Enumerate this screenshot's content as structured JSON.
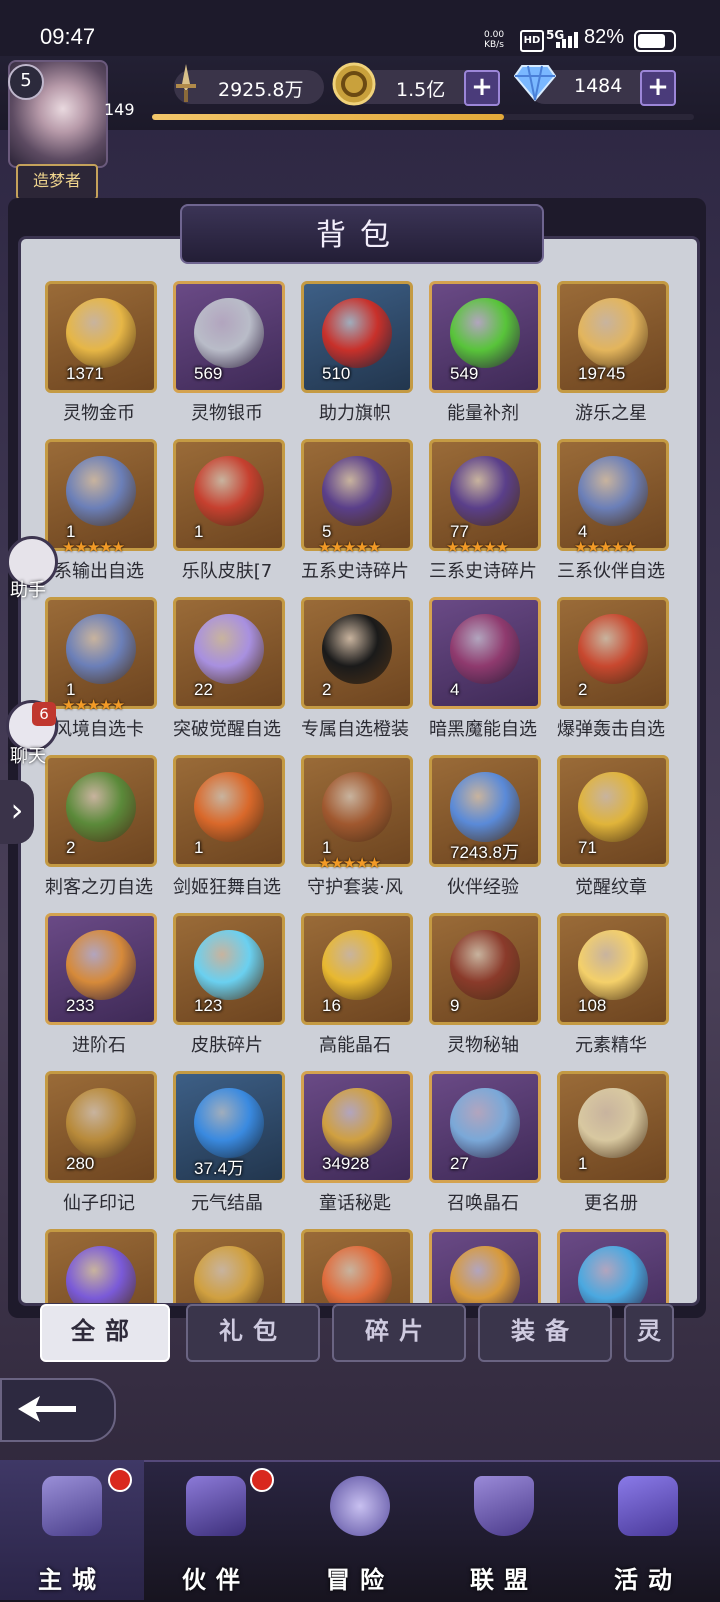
{
  "status_bar": {
    "time": "09:47",
    "net_speed_value": "0.00",
    "net_speed_unit": "KB/s",
    "hd": "HD",
    "signal": "5G",
    "battery": "82%",
    "battery_level": 0.82
  },
  "player": {
    "level": "5",
    "exp": "149",
    "exp_progress": 0.65,
    "title": "造梦者"
  },
  "resources": {
    "power": "2925.8万",
    "gold": "1.5亿",
    "diamond": "1484",
    "plus": "+"
  },
  "panel": {
    "title": "背包"
  },
  "items": [
    {
      "name": "灵物金币",
      "count": "1371",
      "style": "gold",
      "color": "#e6b646",
      "stars": ""
    },
    {
      "name": "灵物银币",
      "count": "569",
      "style": "purple",
      "color": "#b9bcc8",
      "stars": ""
    },
    {
      "name": "助力旗帜",
      "count": "510",
      "style": "blue",
      "color": "#c8302a",
      "stars": ""
    },
    {
      "name": "能量补剂",
      "count": "549",
      "style": "purple",
      "color": "#58c43a",
      "stars": ""
    },
    {
      "name": "游乐之星",
      "count": "19745",
      "style": "gold",
      "color": "#e3b55c",
      "stars": ""
    },
    {
      "name": "系输出自选",
      "count": "1",
      "style": "gold",
      "color": "#6b7fb8",
      "stars": "★★★★★"
    },
    {
      "name": "乐队皮肤[7",
      "count": "1",
      "style": "gold",
      "color": "#c6402f",
      "stars": ""
    },
    {
      "name": "五系史诗碎片",
      "count": "5",
      "style": "gold",
      "color": "#5a3f8a",
      "stars": "★★★★★"
    },
    {
      "name": "三系史诗碎片",
      "count": "77",
      "style": "gold",
      "color": "#5a3f8a",
      "stars": "★★★★★"
    },
    {
      "name": "三系伙伴自选",
      "count": "4",
      "style": "gold",
      "color": "#6b7fb8",
      "stars": "★★★★★"
    },
    {
      "name": "风境自选卡",
      "count": "1",
      "style": "gold",
      "color": "#6b7fb8",
      "stars": "★★★★★"
    },
    {
      "name": "突破觉醒自选",
      "count": "22",
      "style": "gold",
      "color": "#a890e0",
      "stars": ""
    },
    {
      "name": "专属自选橙装",
      "count": "2",
      "style": "gold",
      "color": "#1a1a1a",
      "stars": ""
    },
    {
      "name": "暗黑魔能自选",
      "count": "4",
      "style": "purple",
      "color": "#8f3a6e",
      "stars": ""
    },
    {
      "name": "爆弹轰击自选",
      "count": "2",
      "style": "gold",
      "color": "#c8482f",
      "stars": ""
    },
    {
      "name": "刺客之刃自选",
      "count": "2",
      "style": "gold",
      "color": "#5b8a3a",
      "stars": ""
    },
    {
      "name": "剑姬狂舞自选",
      "count": "1",
      "style": "gold",
      "color": "#d9682a",
      "stars": ""
    },
    {
      "name": "守护套装·风",
      "count": "1",
      "style": "gold",
      "color": "#a0582f",
      "stars": "★★★★★"
    },
    {
      "name": "伙伴经验",
      "count": "7243.8万",
      "style": "gold",
      "color": "#5a8ad8",
      "stars": ""
    },
    {
      "name": "觉醒纹章",
      "count": "71",
      "style": "gold",
      "color": "#e0b43a",
      "stars": ""
    },
    {
      "name": "进阶石",
      "count": "233",
      "style": "purple",
      "color": "#d68a3a",
      "stars": ""
    },
    {
      "name": "皮肤碎片",
      "count": "123",
      "style": "gold",
      "color": "#6ad0f0",
      "stars": ""
    },
    {
      "name": "高能晶石",
      "count": "16",
      "style": "gold",
      "color": "#e8b830",
      "stars": ""
    },
    {
      "name": "灵物秘轴",
      "count": "9",
      "style": "gold",
      "color": "#8a3a2a",
      "stars": ""
    },
    {
      "name": "元素精华",
      "count": "108",
      "style": "gold",
      "color": "#f4d06a",
      "stars": ""
    },
    {
      "name": "仙子印记",
      "count": "280",
      "style": "gold",
      "color": "#b88a3a",
      "stars": ""
    },
    {
      "name": "元气结晶",
      "count": "37.4万",
      "style": "blue",
      "color": "#3a8ae0",
      "stars": ""
    },
    {
      "name": "童话秘匙",
      "count": "34928",
      "style": "purple",
      "color": "#d0a040",
      "stars": ""
    },
    {
      "name": "召唤晶石",
      "count": "27",
      "style": "purple",
      "color": "#7aa8d8",
      "stars": ""
    },
    {
      "name": "更名册",
      "count": "1",
      "style": "gold",
      "color": "#d8c8a0",
      "stars": ""
    }
  ],
  "tabs": [
    "全部",
    "礼包",
    "碎片",
    "装备",
    "灵"
  ],
  "side": {
    "assistant": "助手",
    "chat": "聊天",
    "chat_badge": "6"
  },
  "nav": [
    "主城",
    "伙伴",
    "冒险",
    "联盟",
    "活动"
  ]
}
